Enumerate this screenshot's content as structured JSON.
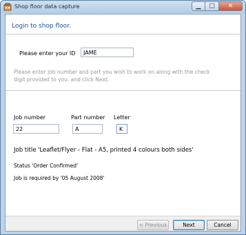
{
  "window": {
    "title": "Shop floor data capture"
  },
  "header": {
    "title": "Login to shop floor."
  },
  "login": {
    "id_label": "Please enter your ID",
    "id_value": "JAME",
    "instructions": "Please enter job number and part you wish to work on along with the check digit provided to you. and click Next."
  },
  "job": {
    "job_number_label": "Job number",
    "job_number_value": "22",
    "part_number_label": "Part number",
    "part_number_value": "A",
    "letter_label": "Letter",
    "letter_value": "K",
    "title_text": "Job title 'Leaflet/Flyer - Flat - A5, printed 4 colours both sides'",
    "status_text": "Status 'Order Confirmed'",
    "required_text": "Job is required by '05 August 2008'"
  },
  "footer": {
    "previous_label": "< Previous",
    "next_label": "Next",
    "cancel_label": "Cancel"
  },
  "icons": {
    "app": "app-icon",
    "minimize": "minimize-icon",
    "maximize": "maximize-icon",
    "close": "close-icon"
  },
  "colors": {
    "header_text": "#1a4f9a",
    "instruction_text": "#999999",
    "close_button": "#c9523a"
  }
}
